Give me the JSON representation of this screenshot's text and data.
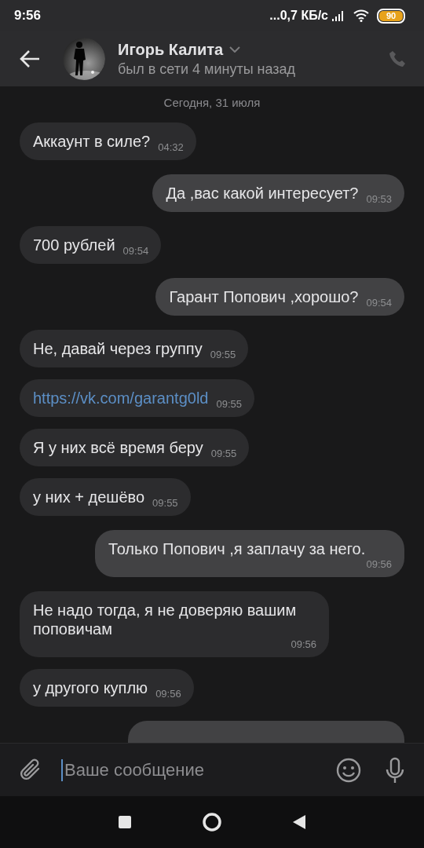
{
  "status_bar": {
    "time": "9:56",
    "network_speed": "...0,7 КБ/с",
    "battery": "90"
  },
  "header": {
    "name": "Игорь Калита",
    "status": "был в сети 4 минуты назад"
  },
  "date_divider": "Сегодня, 31 июля",
  "messages": [
    {
      "outgoing": false,
      "kind": "text",
      "text": "Аккаунт в силе?",
      "time": "04:32"
    },
    {
      "outgoing": true,
      "kind": "text",
      "text": "Да ,вас какой интересует?",
      "time": "09:53"
    },
    {
      "outgoing": false,
      "kind": "text",
      "text": "700 рублей",
      "time": "09:54"
    },
    {
      "outgoing": true,
      "kind": "text",
      "text": "Гарант Попович ,хорошо?",
      "time": "09:54"
    },
    {
      "outgoing": false,
      "kind": "text",
      "text": "Не, давай через группу",
      "time": "09:55"
    },
    {
      "outgoing": false,
      "kind": "link",
      "text": "https://vk.com/garantg0ld",
      "time": "09:55"
    },
    {
      "outgoing": false,
      "kind": "text",
      "text": "Я у них всё время беру",
      "time": "09:55"
    },
    {
      "outgoing": false,
      "kind": "text",
      "text": "у них + дешёво",
      "time": "09:55"
    },
    {
      "outgoing": true,
      "kind": "text",
      "text": "Только Попович ,я заплачу за него.",
      "time": "09:56"
    },
    {
      "outgoing": false,
      "kind": "text",
      "text": "Не надо тогда, я не доверяю вашим поповичам",
      "time": "09:56"
    },
    {
      "outgoing": false,
      "kind": "text",
      "text": "у другого куплю",
      "time": "09:56"
    },
    {
      "outgoing": true,
      "kind": "text"
    }
  ],
  "composer": {
    "placeholder": "Ваше сообщение"
  }
}
